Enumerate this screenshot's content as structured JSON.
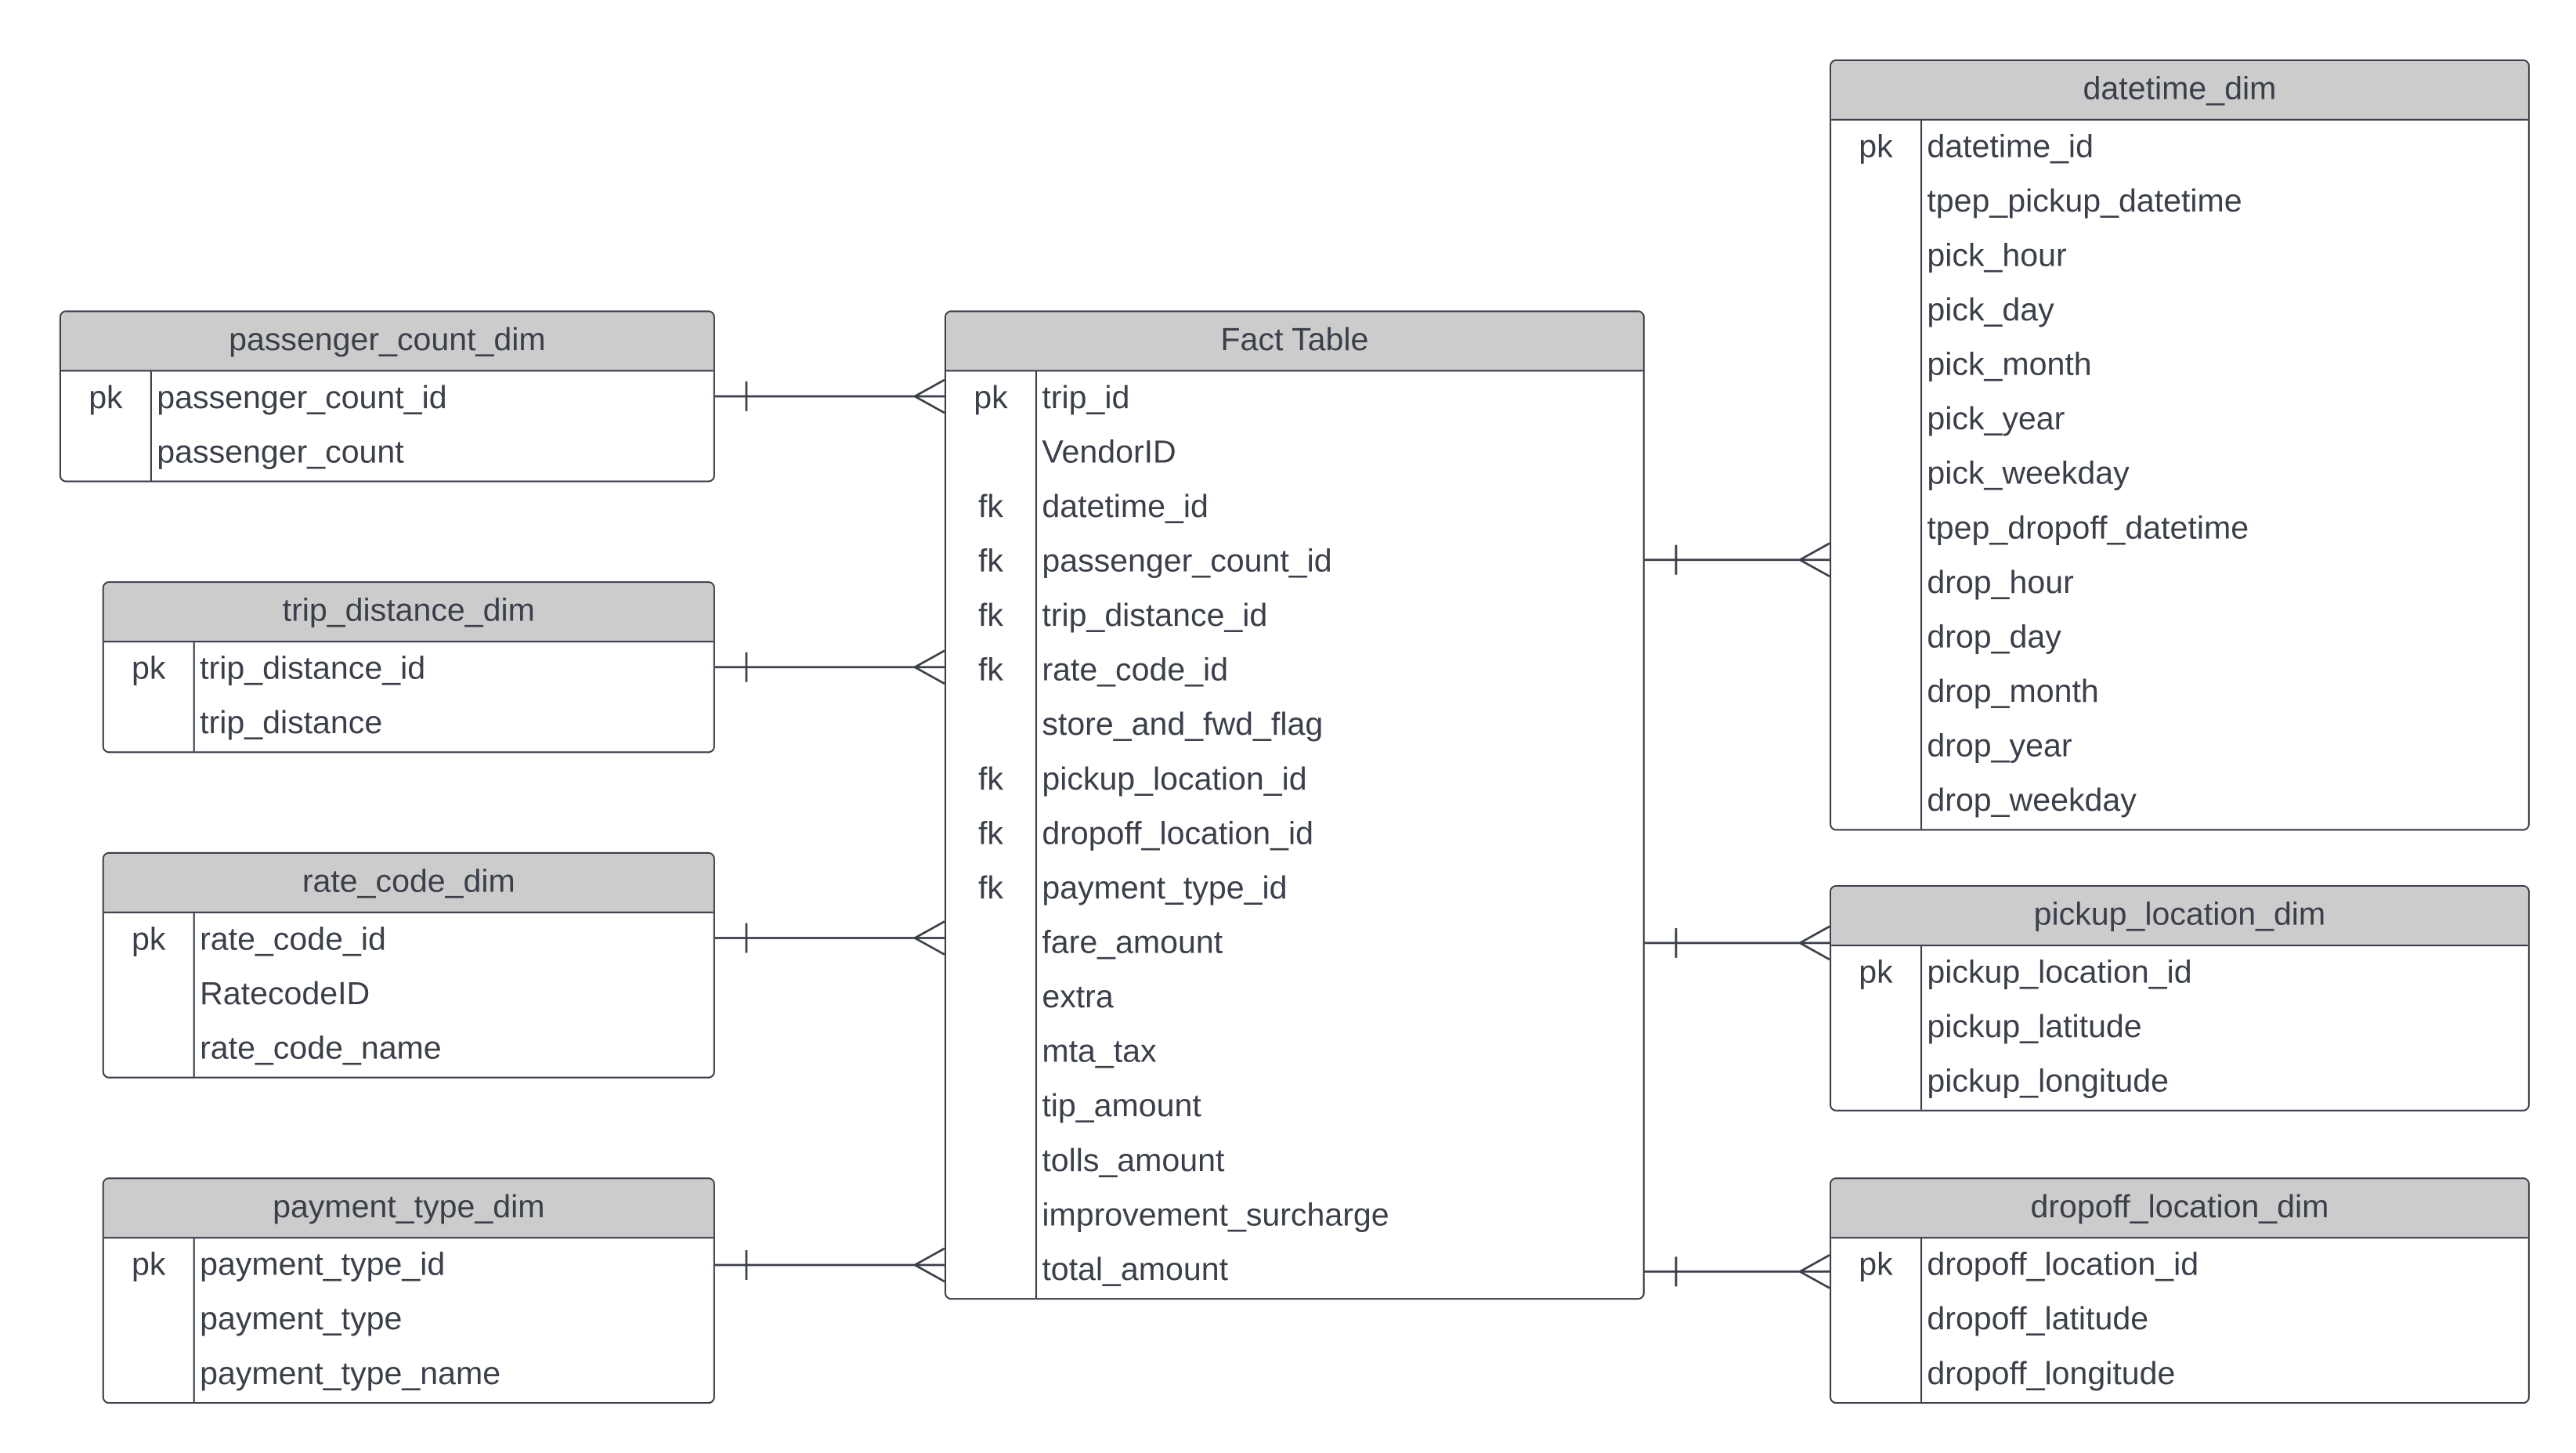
{
  "tables": [
    {
      "id": "passenger_count_dim",
      "title": "passenger_count_dim",
      "rows": [
        {
          "key": "pk",
          "field": "passenger_count_id"
        },
        {
          "key": "",
          "field": "passenger_count"
        }
      ]
    },
    {
      "id": "trip_distance_dim",
      "title": "trip_distance_dim",
      "rows": [
        {
          "key": "pk",
          "field": "trip_distance_id"
        },
        {
          "key": "",
          "field": "trip_distance"
        }
      ]
    },
    {
      "id": "rate_code_dim",
      "title": "rate_code_dim",
      "rows": [
        {
          "key": "pk",
          "field": "rate_code_id"
        },
        {
          "key": "",
          "field": "RatecodeID"
        },
        {
          "key": "",
          "field": "rate_code_name"
        }
      ]
    },
    {
      "id": "payment_type_dim",
      "title": "payment_type_dim",
      "rows": [
        {
          "key": "pk",
          "field": "payment_type_id"
        },
        {
          "key": "",
          "field": "payment_type"
        },
        {
          "key": "",
          "field": "payment_type_name"
        }
      ]
    },
    {
      "id": "fact_table",
      "title": "Fact Table",
      "rows": [
        {
          "key": "pk",
          "field": "trip_id"
        },
        {
          "key": "",
          "field": "VendorID"
        },
        {
          "key": "fk",
          "field": "datetime_id"
        },
        {
          "key": "fk",
          "field": "passenger_count_id"
        },
        {
          "key": "fk",
          "field": "trip_distance_id"
        },
        {
          "key": "fk",
          "field": "rate_code_id"
        },
        {
          "key": "",
          "field": "store_and_fwd_flag"
        },
        {
          "key": "fk",
          "field": "pickup_location_id"
        },
        {
          "key": "fk",
          "field": "dropoff_location_id"
        },
        {
          "key": "fk",
          "field": "payment_type_id"
        },
        {
          "key": "",
          "field": "fare_amount"
        },
        {
          "key": "",
          "field": "extra"
        },
        {
          "key": "",
          "field": "mta_tax"
        },
        {
          "key": "",
          "field": "tip_amount"
        },
        {
          "key": "",
          "field": "tolls_amount"
        },
        {
          "key": "",
          "field": "improvement_surcharge"
        },
        {
          "key": "",
          "field": "total_amount"
        }
      ]
    },
    {
      "id": "datetime_dim",
      "title": "datetime_dim",
      "rows": [
        {
          "key": "pk",
          "field": "datetime_id"
        },
        {
          "key": "",
          "field": "tpep_pickup_datetime"
        },
        {
          "key": "",
          "field": "pick_hour"
        },
        {
          "key": "",
          "field": "pick_day"
        },
        {
          "key": "",
          "field": "pick_month"
        },
        {
          "key": "",
          "field": "pick_year"
        },
        {
          "key": "",
          "field": "pick_weekday"
        },
        {
          "key": "",
          "field": "tpep_dropoff_datetime"
        },
        {
          "key": "",
          "field": "drop_hour"
        },
        {
          "key": "",
          "field": "drop_day"
        },
        {
          "key": "",
          "field": "drop_month"
        },
        {
          "key": "",
          "field": "drop_year"
        },
        {
          "key": "",
          "field": "drop_weekday"
        }
      ]
    },
    {
      "id": "pickup_location_dim",
      "title": "pickup_location_dim",
      "rows": [
        {
          "key": "pk",
          "field": "pickup_location_id"
        },
        {
          "key": "",
          "field": "pickup_latitude"
        },
        {
          "key": "",
          "field": "pickup_longitude"
        }
      ]
    },
    {
      "id": "dropoff_location_dim",
      "title": "dropoff_location_dim",
      "rows": [
        {
          "key": "pk",
          "field": "dropoff_location_id"
        },
        {
          "key": "",
          "field": "dropoff_latitude"
        },
        {
          "key": "",
          "field": "dropoff_longitude"
        }
      ]
    }
  ],
  "relationships": [
    {
      "from": "passenger_count_dim",
      "to": "fact_table",
      "cardinality": "one-to-many"
    },
    {
      "from": "trip_distance_dim",
      "to": "fact_table",
      "cardinality": "one-to-many"
    },
    {
      "from": "rate_code_dim",
      "to": "fact_table",
      "cardinality": "one-to-many"
    },
    {
      "from": "payment_type_dim",
      "to": "fact_table",
      "cardinality": "one-to-many"
    },
    {
      "from": "fact_table",
      "to": "datetime_dim",
      "cardinality": "one-to-many"
    },
    {
      "from": "fact_table",
      "to": "pickup_location_dim",
      "cardinality": "one-to-many"
    },
    {
      "from": "fact_table",
      "to": "dropoff_location_dim",
      "cardinality": "one-to-many"
    }
  ],
  "colors": {
    "header": "#cccccc",
    "stroke": "#3a3f4a"
  }
}
